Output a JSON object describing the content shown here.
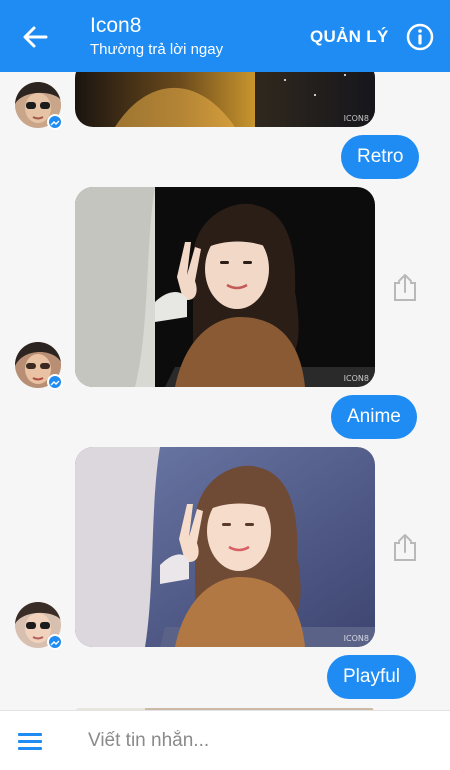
{
  "header": {
    "title": "Icon8",
    "subtitle": "Thường trả lời ngay",
    "manage_label": "QUẢN LÝ"
  },
  "messages": [
    {
      "type": "image",
      "sender": "contact"
    },
    {
      "type": "text",
      "sender": "me",
      "text": "Retro"
    },
    {
      "type": "image",
      "sender": "contact"
    },
    {
      "type": "text",
      "sender": "me",
      "text": "Anime"
    },
    {
      "type": "image",
      "sender": "contact"
    },
    {
      "type": "text",
      "sender": "me",
      "text": "Playful"
    }
  ],
  "watermarks": [
    "ICON8",
    "ICON8",
    "ICON8"
  ],
  "composer": {
    "placeholder": "Viết tin nhắn..."
  },
  "colors": {
    "accent": "#1e8cf2",
    "background": "#f6f6f6"
  },
  "icons": [
    "back-arrow-icon",
    "info-icon",
    "share-icon",
    "menu-icon",
    "messenger-badge-icon"
  ]
}
